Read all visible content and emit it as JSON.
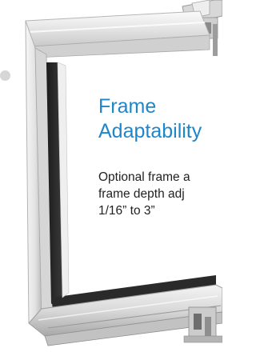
{
  "theme": {
    "accent": "#1f86c8"
  },
  "feature": {
    "title_line1": "Frame",
    "title_line2": "Adaptability",
    "desc_line1": "Optional frame a",
    "desc_line2": "frame depth adj",
    "desc_line3": "1/16” to 3”"
  },
  "icons": [
    "window-frame-illustration",
    "bullet-dot-icon"
  ]
}
